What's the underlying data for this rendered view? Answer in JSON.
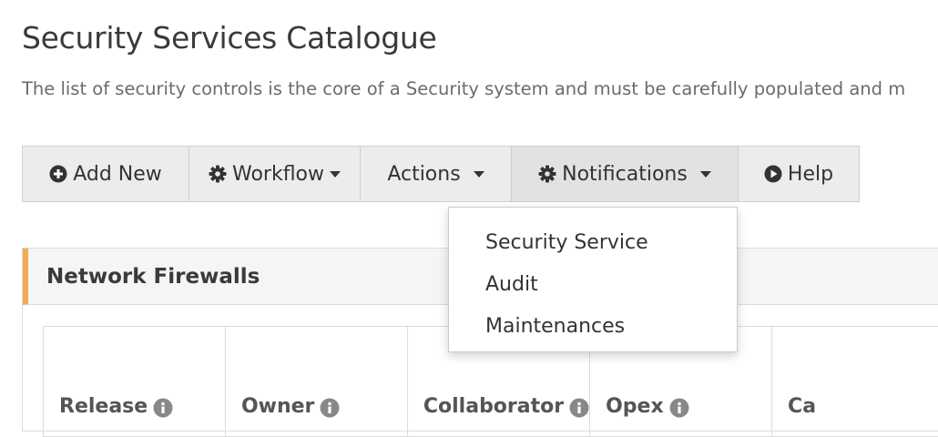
{
  "page": {
    "title": "Security Services Catalogue",
    "description": "The list of security controls is the core of a Security system and must be carefully populated and m"
  },
  "toolbar": {
    "buttons": [
      {
        "label": "Add New",
        "icon": "plus-circle-icon"
      },
      {
        "label": "Workflow",
        "icon": "gear-icon",
        "dropdown": true
      },
      {
        "label": "Actions",
        "dropdown": true
      },
      {
        "label": "Notifications",
        "icon": "gear-icon",
        "dropdown": true,
        "active": true
      },
      {
        "label": "Help",
        "icon": "play-circle-icon"
      }
    ]
  },
  "dropdown": {
    "items": [
      "Security Service",
      "Audit",
      "Maintenances"
    ]
  },
  "panel": {
    "heading": "Network Firewalls",
    "accent_color": "#f0ad4e",
    "columns": [
      "Release",
      "Owner",
      "Collaborator",
      "Opex",
      "Ca"
    ]
  }
}
